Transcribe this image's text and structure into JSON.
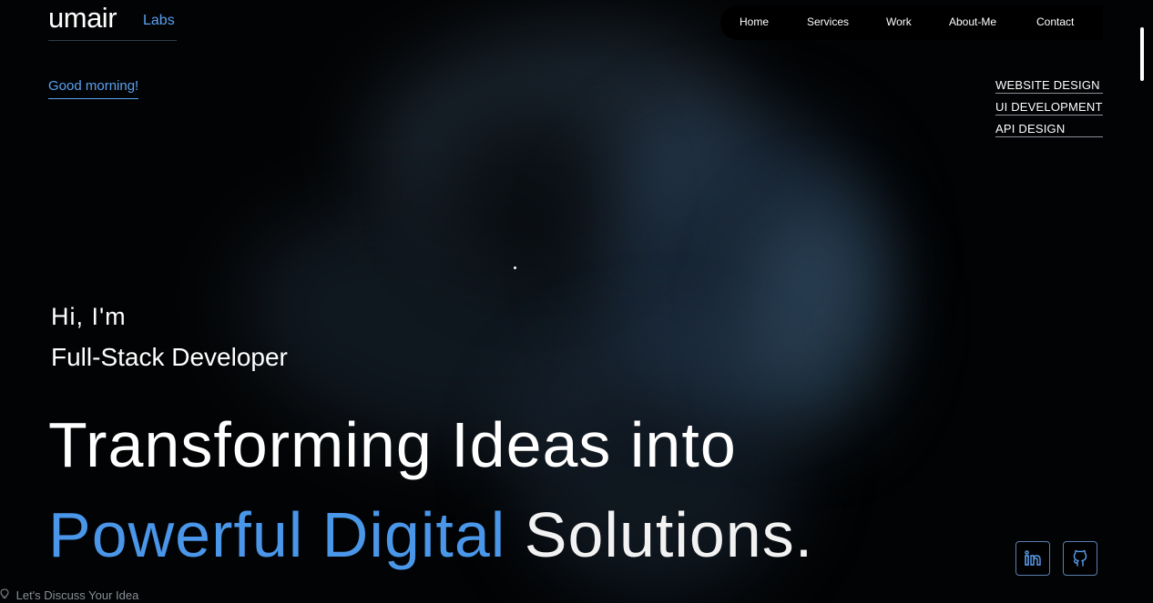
{
  "brand": {
    "name": "umair",
    "sub": "Labs"
  },
  "nav": {
    "items": [
      {
        "label": "Home"
      },
      {
        "label": "Services"
      },
      {
        "label": "Work"
      },
      {
        "label": "About-Me"
      },
      {
        "label": "Contact"
      }
    ]
  },
  "greeting": "Good morning!",
  "services": [
    {
      "label": "WEBSITE DESIGN"
    },
    {
      "label": "UI DEVELOPMENT"
    },
    {
      "label": "API DESIGN"
    }
  ],
  "hero": {
    "intro": "Hi, I'm",
    "role": "Full-Stack Developer",
    "line1": "Transforming Ideas into",
    "line2_accent": "Powerful Digital",
    "line2_rest": "Solutions."
  },
  "social": [
    {
      "icon": "linkedin-icon"
    },
    {
      "icon": "github-icon"
    }
  ],
  "cta": {
    "label": "Let's Discuss Your Idea",
    "icon": "lightbulb-icon"
  },
  "colors": {
    "accent": "#4a96e8",
    "background": "#000000",
    "text": "#ffffff"
  }
}
